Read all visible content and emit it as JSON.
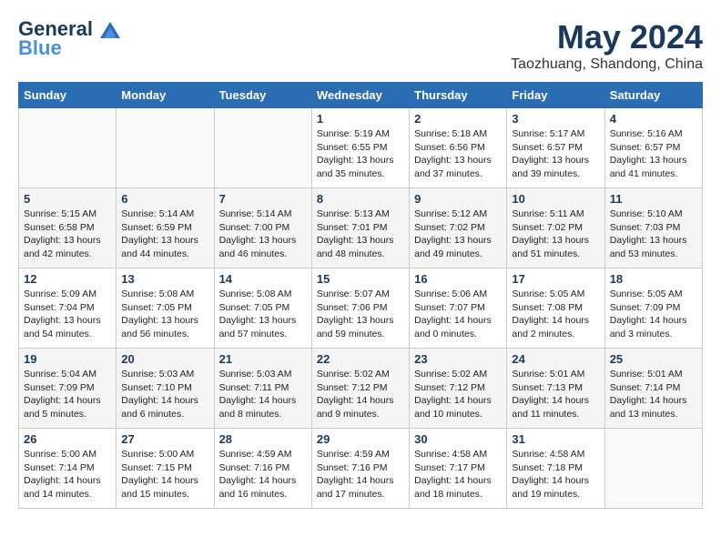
{
  "header": {
    "logo_line1": "General",
    "logo_line2": "Blue",
    "month": "May 2024",
    "location": "Taozhuang, Shandong, China"
  },
  "weekdays": [
    "Sunday",
    "Monday",
    "Tuesday",
    "Wednesday",
    "Thursday",
    "Friday",
    "Saturday"
  ],
  "weeks": [
    [
      {
        "day": "",
        "info": ""
      },
      {
        "day": "",
        "info": ""
      },
      {
        "day": "",
        "info": ""
      },
      {
        "day": "1",
        "info": "Sunrise: 5:19 AM\nSunset: 6:55 PM\nDaylight: 13 hours\nand 35 minutes."
      },
      {
        "day": "2",
        "info": "Sunrise: 5:18 AM\nSunset: 6:56 PM\nDaylight: 13 hours\nand 37 minutes."
      },
      {
        "day": "3",
        "info": "Sunrise: 5:17 AM\nSunset: 6:57 PM\nDaylight: 13 hours\nand 39 minutes."
      },
      {
        "day": "4",
        "info": "Sunrise: 5:16 AM\nSunset: 6:57 PM\nDaylight: 13 hours\nand 41 minutes."
      }
    ],
    [
      {
        "day": "5",
        "info": "Sunrise: 5:15 AM\nSunset: 6:58 PM\nDaylight: 13 hours\nand 42 minutes."
      },
      {
        "day": "6",
        "info": "Sunrise: 5:14 AM\nSunset: 6:59 PM\nDaylight: 13 hours\nand 44 minutes."
      },
      {
        "day": "7",
        "info": "Sunrise: 5:14 AM\nSunset: 7:00 PM\nDaylight: 13 hours\nand 46 minutes."
      },
      {
        "day": "8",
        "info": "Sunrise: 5:13 AM\nSunset: 7:01 PM\nDaylight: 13 hours\nand 48 minutes."
      },
      {
        "day": "9",
        "info": "Sunrise: 5:12 AM\nSunset: 7:02 PM\nDaylight: 13 hours\nand 49 minutes."
      },
      {
        "day": "10",
        "info": "Sunrise: 5:11 AM\nSunset: 7:02 PM\nDaylight: 13 hours\nand 51 minutes."
      },
      {
        "day": "11",
        "info": "Sunrise: 5:10 AM\nSunset: 7:03 PM\nDaylight: 13 hours\nand 53 minutes."
      }
    ],
    [
      {
        "day": "12",
        "info": "Sunrise: 5:09 AM\nSunset: 7:04 PM\nDaylight: 13 hours\nand 54 minutes."
      },
      {
        "day": "13",
        "info": "Sunrise: 5:08 AM\nSunset: 7:05 PM\nDaylight: 13 hours\nand 56 minutes."
      },
      {
        "day": "14",
        "info": "Sunrise: 5:08 AM\nSunset: 7:05 PM\nDaylight: 13 hours\nand 57 minutes."
      },
      {
        "day": "15",
        "info": "Sunrise: 5:07 AM\nSunset: 7:06 PM\nDaylight: 13 hours\nand 59 minutes."
      },
      {
        "day": "16",
        "info": "Sunrise: 5:06 AM\nSunset: 7:07 PM\nDaylight: 14 hours\nand 0 minutes."
      },
      {
        "day": "17",
        "info": "Sunrise: 5:05 AM\nSunset: 7:08 PM\nDaylight: 14 hours\nand 2 minutes."
      },
      {
        "day": "18",
        "info": "Sunrise: 5:05 AM\nSunset: 7:09 PM\nDaylight: 14 hours\nand 3 minutes."
      }
    ],
    [
      {
        "day": "19",
        "info": "Sunrise: 5:04 AM\nSunset: 7:09 PM\nDaylight: 14 hours\nand 5 minutes."
      },
      {
        "day": "20",
        "info": "Sunrise: 5:03 AM\nSunset: 7:10 PM\nDaylight: 14 hours\nand 6 minutes."
      },
      {
        "day": "21",
        "info": "Sunrise: 5:03 AM\nSunset: 7:11 PM\nDaylight: 14 hours\nand 8 minutes."
      },
      {
        "day": "22",
        "info": "Sunrise: 5:02 AM\nSunset: 7:12 PM\nDaylight: 14 hours\nand 9 minutes."
      },
      {
        "day": "23",
        "info": "Sunrise: 5:02 AM\nSunset: 7:12 PM\nDaylight: 14 hours\nand 10 minutes."
      },
      {
        "day": "24",
        "info": "Sunrise: 5:01 AM\nSunset: 7:13 PM\nDaylight: 14 hours\nand 11 minutes."
      },
      {
        "day": "25",
        "info": "Sunrise: 5:01 AM\nSunset: 7:14 PM\nDaylight: 14 hours\nand 13 minutes."
      }
    ],
    [
      {
        "day": "26",
        "info": "Sunrise: 5:00 AM\nSunset: 7:14 PM\nDaylight: 14 hours\nand 14 minutes."
      },
      {
        "day": "27",
        "info": "Sunrise: 5:00 AM\nSunset: 7:15 PM\nDaylight: 14 hours\nand 15 minutes."
      },
      {
        "day": "28",
        "info": "Sunrise: 4:59 AM\nSunset: 7:16 PM\nDaylight: 14 hours\nand 16 minutes."
      },
      {
        "day": "29",
        "info": "Sunrise: 4:59 AM\nSunset: 7:16 PM\nDaylight: 14 hours\nand 17 minutes."
      },
      {
        "day": "30",
        "info": "Sunrise: 4:58 AM\nSunset: 7:17 PM\nDaylight: 14 hours\nand 18 minutes."
      },
      {
        "day": "31",
        "info": "Sunrise: 4:58 AM\nSunset: 7:18 PM\nDaylight: 14 hours\nand 19 minutes."
      },
      {
        "day": "",
        "info": ""
      }
    ]
  ]
}
